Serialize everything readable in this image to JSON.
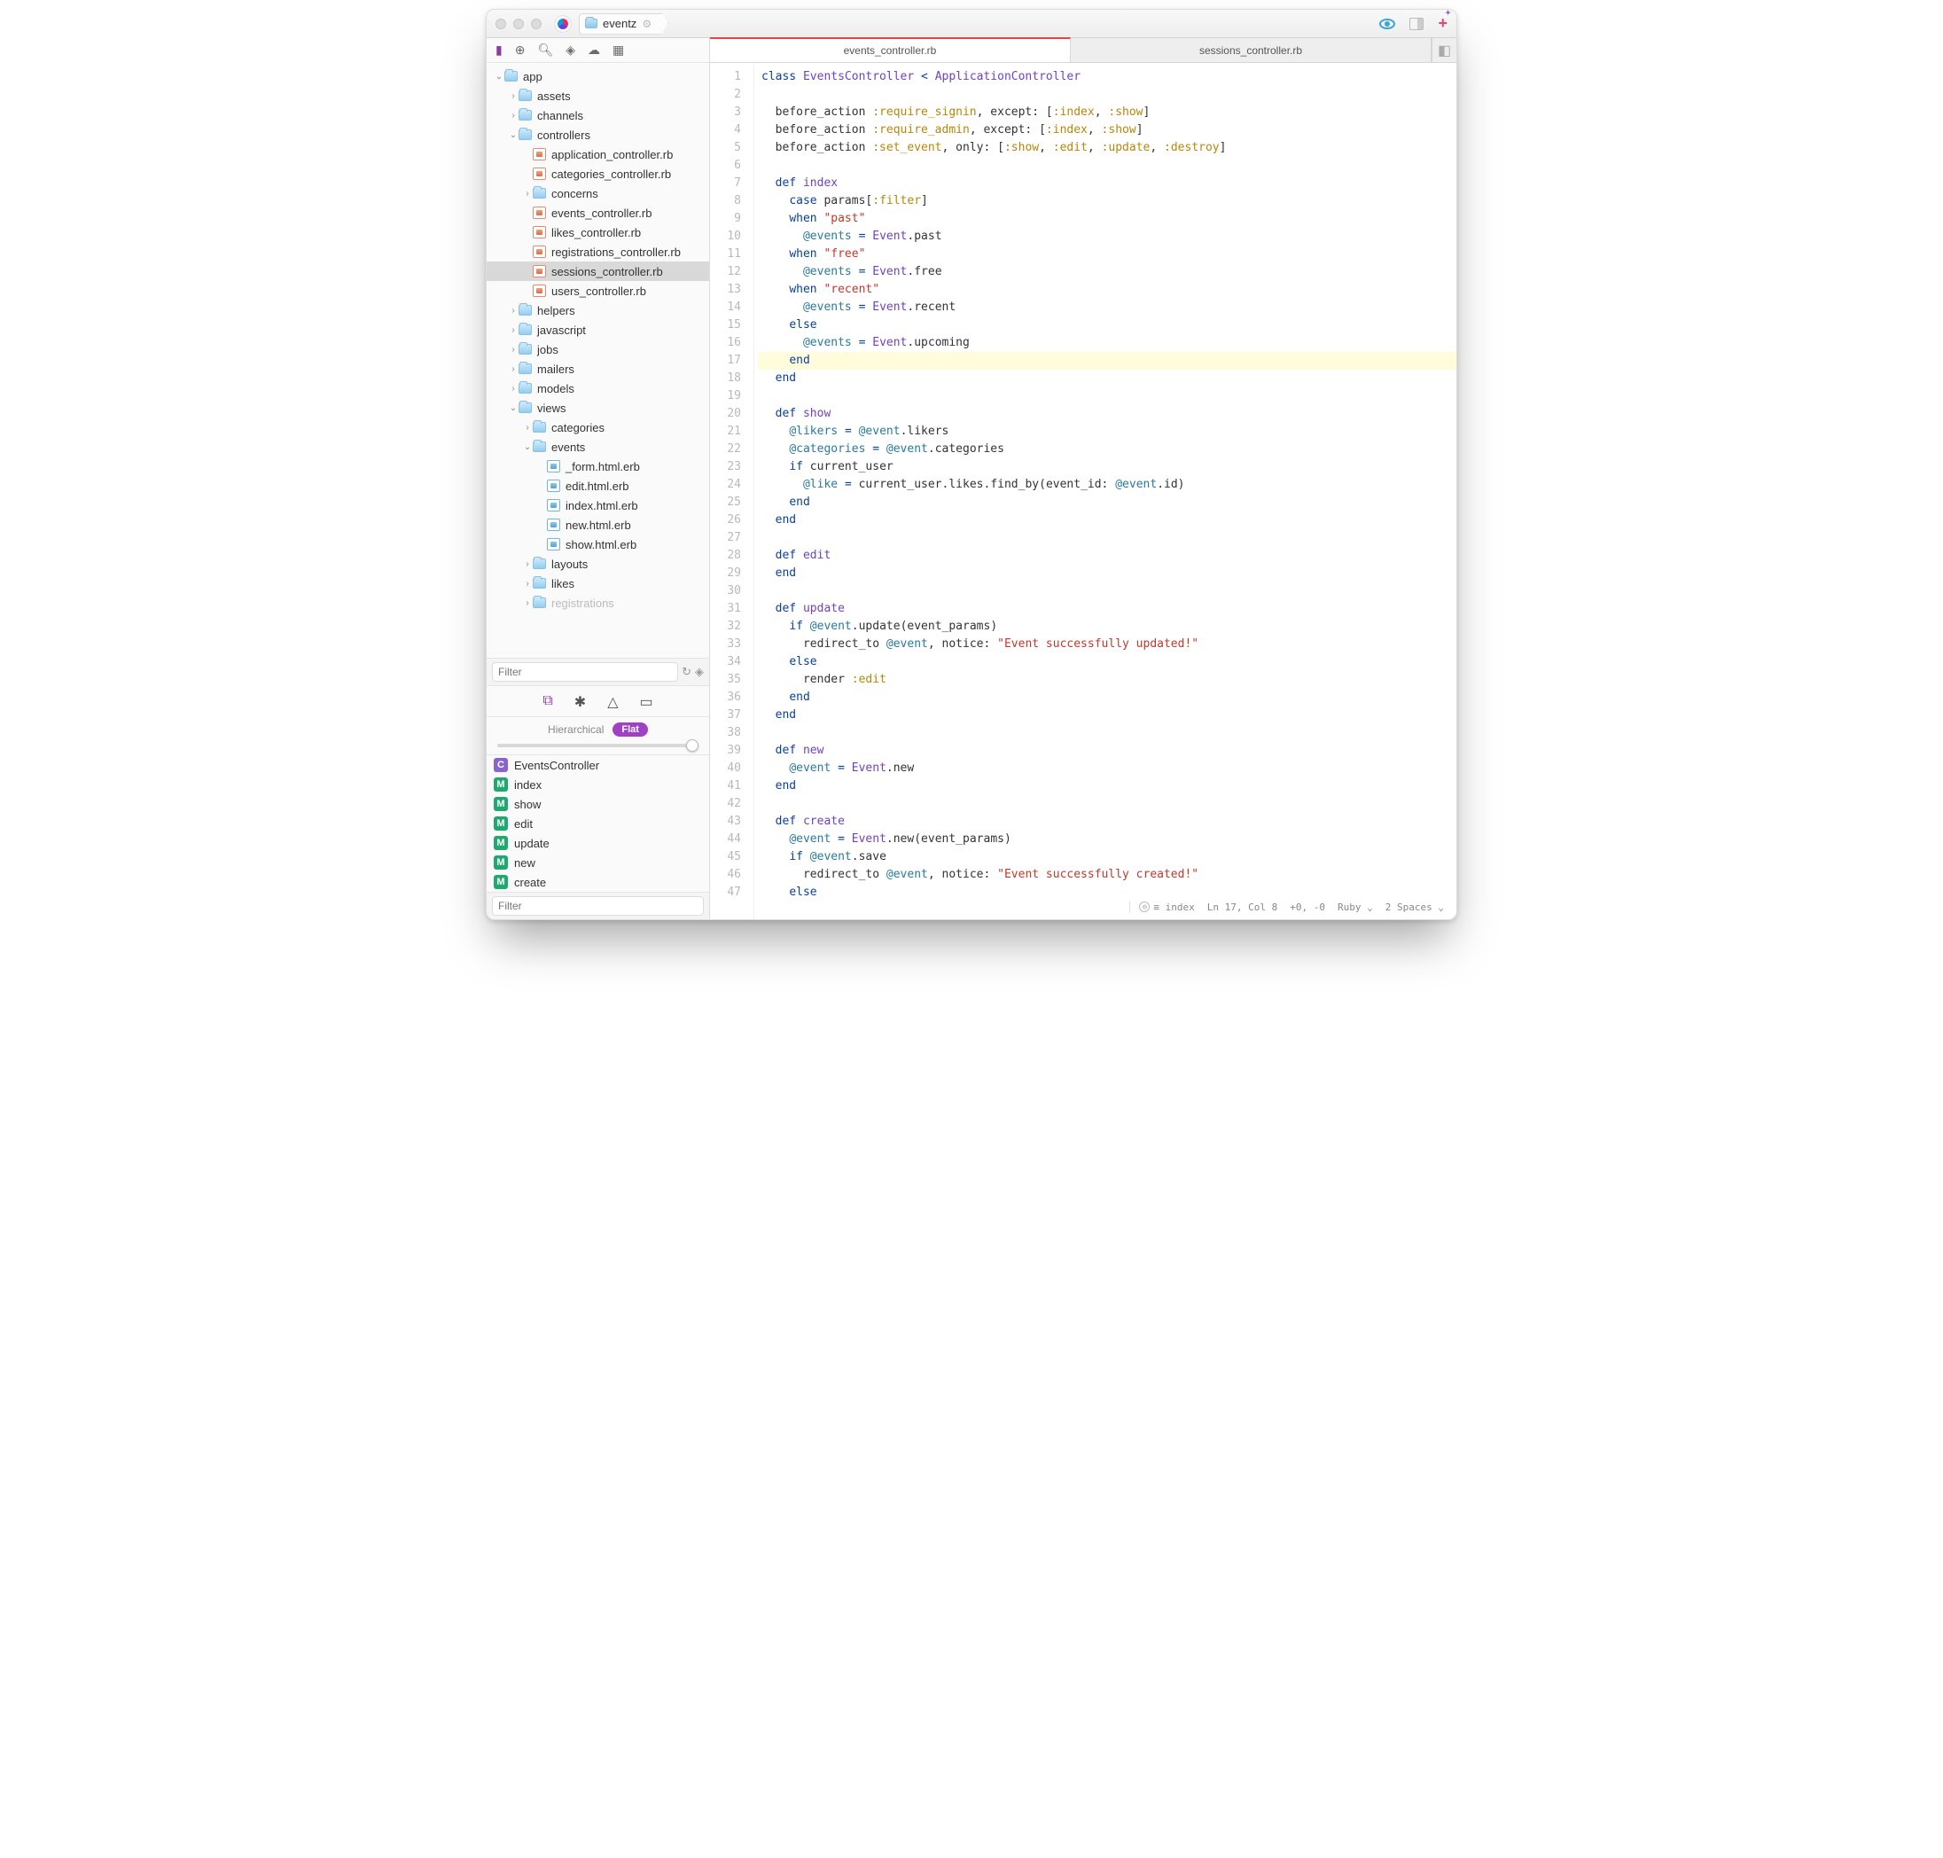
{
  "titlebar": {
    "project_name": "eventz"
  },
  "tabs": [
    {
      "label": "events_controller.rb",
      "active": true
    },
    {
      "label": "sessions_controller.rb",
      "active": false
    }
  ],
  "tree": [
    {
      "d": 0,
      "kind": "folder",
      "label": "app",
      "open": true,
      "tw": "v"
    },
    {
      "d": 1,
      "kind": "folder",
      "label": "assets",
      "tw": ">"
    },
    {
      "d": 1,
      "kind": "folder",
      "label": "channels",
      "tw": ">"
    },
    {
      "d": 1,
      "kind": "folder",
      "label": "controllers",
      "open": true,
      "tw": "v"
    },
    {
      "d": 2,
      "kind": "ruby",
      "label": "application_controller.rb"
    },
    {
      "d": 2,
      "kind": "ruby",
      "label": "categories_controller.rb"
    },
    {
      "d": 2,
      "kind": "folder",
      "label": "concerns",
      "tw": ">"
    },
    {
      "d": 2,
      "kind": "ruby",
      "label": "events_controller.rb"
    },
    {
      "d": 2,
      "kind": "ruby",
      "label": "likes_controller.rb"
    },
    {
      "d": 2,
      "kind": "ruby",
      "label": "registrations_controller.rb"
    },
    {
      "d": 2,
      "kind": "ruby",
      "label": "sessions_controller.rb",
      "selected": true
    },
    {
      "d": 2,
      "kind": "ruby",
      "label": "users_controller.rb"
    },
    {
      "d": 1,
      "kind": "folder",
      "label": "helpers",
      "tw": ">"
    },
    {
      "d": 1,
      "kind": "folder",
      "label": "javascript",
      "tw": ">"
    },
    {
      "d": 1,
      "kind": "folder",
      "label": "jobs",
      "tw": ">"
    },
    {
      "d": 1,
      "kind": "folder",
      "label": "mailers",
      "tw": ">"
    },
    {
      "d": 1,
      "kind": "folder",
      "label": "models",
      "tw": ">"
    },
    {
      "d": 1,
      "kind": "folder",
      "label": "views",
      "open": true,
      "tw": "v"
    },
    {
      "d": 2,
      "kind": "folder",
      "label": "categories",
      "tw": ">"
    },
    {
      "d": 2,
      "kind": "folder",
      "label": "events",
      "open": true,
      "tw": "v"
    },
    {
      "d": 3,
      "kind": "erb",
      "label": "_form.html.erb"
    },
    {
      "d": 3,
      "kind": "erb",
      "label": "edit.html.erb"
    },
    {
      "d": 3,
      "kind": "erb",
      "label": "index.html.erb"
    },
    {
      "d": 3,
      "kind": "erb",
      "label": "new.html.erb"
    },
    {
      "d": 3,
      "kind": "erb",
      "label": "show.html.erb"
    },
    {
      "d": 2,
      "kind": "folder",
      "label": "layouts",
      "tw": ">"
    },
    {
      "d": 2,
      "kind": "folder",
      "label": "likes",
      "tw": ">"
    },
    {
      "d": 2,
      "kind": "folder",
      "label": "registrations",
      "tw": ">",
      "faded": true
    }
  ],
  "filter_placeholder": "Filter",
  "structure_modes": {
    "hierarchical": "Hierarchical",
    "flat": "Flat"
  },
  "symbols": [
    {
      "badge": "C",
      "name": "EventsController"
    },
    {
      "badge": "M",
      "name": "index"
    },
    {
      "badge": "M",
      "name": "show"
    },
    {
      "badge": "M",
      "name": "edit"
    },
    {
      "badge": "M",
      "name": "update"
    },
    {
      "badge": "M",
      "name": "new"
    },
    {
      "badge": "M",
      "name": "create"
    }
  ],
  "code_lines": [
    {
      "n": 1,
      "html": "<span class='kw'>class</span> <span class='cls'>EventsController</span> <span class='op'>&lt;</span> <span class='cls'>ApplicationController</span>"
    },
    {
      "n": 2,
      "html": ""
    },
    {
      "n": 3,
      "html": "  <span class='id'>before_action</span> <span class='sym'>:require_signin</span><span class='pn'>,</span> <span class='id'>except:</span> <span class='pn'>[</span><span class='sym'>:index</span><span class='pn'>,</span> <span class='sym'>:show</span><span class='pn'>]</span>"
    },
    {
      "n": 4,
      "html": "  <span class='id'>before_action</span> <span class='sym'>:require_admin</span><span class='pn'>,</span> <span class='id'>except:</span> <span class='pn'>[</span><span class='sym'>:index</span><span class='pn'>,</span> <span class='sym'>:show</span><span class='pn'>]</span>"
    },
    {
      "n": 5,
      "html": "  <span class='id'>before_action</span> <span class='sym'>:set_event</span><span class='pn'>,</span> <span class='id'>only:</span> <span class='pn'>[</span><span class='sym'>:show</span><span class='pn'>,</span> <span class='sym'>:edit</span><span class='pn'>,</span> <span class='sym'>:update</span><span class='pn'>,</span> <span class='sym'>:destroy</span><span class='pn'>]</span>"
    },
    {
      "n": 6,
      "html": ""
    },
    {
      "n": 7,
      "html": "  <span class='kw'>def</span> <span class='fn'>index</span>"
    },
    {
      "n": 8,
      "html": "    <span class='kw'>case</span> <span class='id'>params</span><span class='pn'>[</span><span class='sym'>:filter</span><span class='pn'>]</span>"
    },
    {
      "n": 9,
      "html": "    <span class='kw'>when</span> <span class='str'>\"past\"</span>"
    },
    {
      "n": 10,
      "html": "      <span class='iv'>@events</span> <span class='op'>=</span> <span class='cls'>Event</span><span class='pn'>.</span><span class='id'>past</span>"
    },
    {
      "n": 11,
      "html": "    <span class='kw'>when</span> <span class='str'>\"free\"</span>"
    },
    {
      "n": 12,
      "html": "      <span class='iv'>@events</span> <span class='op'>=</span> <span class='cls'>Event</span><span class='pn'>.</span><span class='id'>free</span>"
    },
    {
      "n": 13,
      "html": "    <span class='kw'>when</span> <span class='str'>\"recent\"</span>"
    },
    {
      "n": 14,
      "html": "      <span class='iv'>@events</span> <span class='op'>=</span> <span class='cls'>Event</span><span class='pn'>.</span><span class='id'>recent</span>"
    },
    {
      "n": 15,
      "html": "    <span class='kw'>else</span>"
    },
    {
      "n": 16,
      "html": "      <span class='iv'>@events</span> <span class='op'>=</span> <span class='cls'>Event</span><span class='pn'>.</span><span class='id'>upcoming</span>"
    },
    {
      "n": 17,
      "html": "    <span class='kw'>end</span>",
      "hl": true
    },
    {
      "n": 18,
      "html": "  <span class='kw'>end</span>"
    },
    {
      "n": 19,
      "html": ""
    },
    {
      "n": 20,
      "html": "  <span class='kw'>def</span> <span class='fn'>show</span>"
    },
    {
      "n": 21,
      "html": "    <span class='iv'>@likers</span> <span class='op'>=</span> <span class='iv'>@event</span><span class='pn'>.</span><span class='id'>likers</span>"
    },
    {
      "n": 22,
      "html": "    <span class='iv'>@categories</span> <span class='op'>=</span> <span class='iv'>@event</span><span class='pn'>.</span><span class='id'>categories</span>"
    },
    {
      "n": 23,
      "html": "    <span class='kw'>if</span> <span class='id'>current_user</span>"
    },
    {
      "n": 24,
      "html": "      <span class='iv'>@like</span> <span class='op'>=</span> <span class='id'>current_user</span><span class='pn'>.</span><span class='id'>likes</span><span class='pn'>.</span><span class='id'>find_by</span><span class='pn'>(</span><span class='id'>event_id:</span> <span class='iv'>@event</span><span class='pn'>.</span><span class='id'>id</span><span class='pn'>)</span>"
    },
    {
      "n": 25,
      "html": "    <span class='kw'>end</span>"
    },
    {
      "n": 26,
      "html": "  <span class='kw'>end</span>"
    },
    {
      "n": 27,
      "html": ""
    },
    {
      "n": 28,
      "html": "  <span class='kw'>def</span> <span class='fn'>edit</span>"
    },
    {
      "n": 29,
      "html": "  <span class='kw'>end</span>"
    },
    {
      "n": 30,
      "html": ""
    },
    {
      "n": 31,
      "html": "  <span class='kw'>def</span> <span class='fn'>update</span>"
    },
    {
      "n": 32,
      "html": "    <span class='kw'>if</span> <span class='iv'>@event</span><span class='pn'>.</span><span class='id'>update</span><span class='pn'>(</span><span class='id'>event_params</span><span class='pn'>)</span>"
    },
    {
      "n": 33,
      "html": "      <span class='id'>redirect_to</span> <span class='iv'>@event</span><span class='pn'>,</span> <span class='id'>notice:</span> <span class='str'>\"Event successfully updated!\"</span>"
    },
    {
      "n": 34,
      "html": "    <span class='kw'>else</span>"
    },
    {
      "n": 35,
      "html": "      <span class='id'>render</span> <span class='sym'>:edit</span>"
    },
    {
      "n": 36,
      "html": "    <span class='kw'>end</span>"
    },
    {
      "n": 37,
      "html": "  <span class='kw'>end</span>"
    },
    {
      "n": 38,
      "html": ""
    },
    {
      "n": 39,
      "html": "  <span class='kw'>def</span> <span class='fn'>new</span>"
    },
    {
      "n": 40,
      "html": "    <span class='iv'>@event</span> <span class='op'>=</span> <span class='cls'>Event</span><span class='pn'>.</span><span class='id'>new</span>"
    },
    {
      "n": 41,
      "html": "  <span class='kw'>end</span>"
    },
    {
      "n": 42,
      "html": ""
    },
    {
      "n": 43,
      "html": "  <span class='kw'>def</span> <span class='fn'>create</span>"
    },
    {
      "n": 44,
      "html": "    <span class='iv'>@event</span> <span class='op'>=</span> <span class='cls'>Event</span><span class='pn'>.</span><span class='id'>new</span><span class='pn'>(</span><span class='id'>event_params</span><span class='pn'>)</span>"
    },
    {
      "n": 45,
      "html": "    <span class='kw'>if</span> <span class='iv'>@event</span><span class='pn'>.</span><span class='id'>save</span>"
    },
    {
      "n": 46,
      "html": "      <span class='id'>redirect_to</span> <span class='iv'>@event</span><span class='pn'>,</span> <span class='id'>notice:</span> <span class='str'>\"Event successfully created!\"</span>"
    },
    {
      "n": 47,
      "html": "    <span class='kw'>else</span>"
    }
  ],
  "status": {
    "breadcrumb": "index",
    "position": "Ln 17, Col 8",
    "diff": "+0, -0",
    "lang": "Ruby",
    "indent": "2 Spaces"
  }
}
